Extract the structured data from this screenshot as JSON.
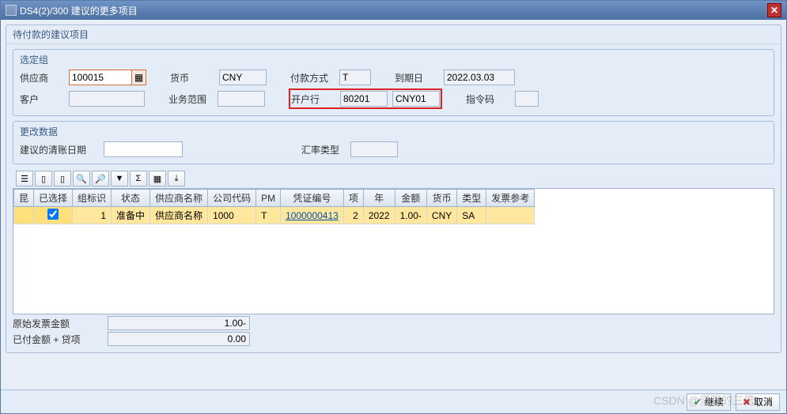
{
  "title": "DS4(2)/300 建议的更多项目",
  "group_main_title": "待付款的建议项目",
  "sel_group_title": "选定组",
  "fields": {
    "vendor_lbl": "供应商",
    "vendor_val": "100015",
    "customer_lbl": "客户",
    "customer_val": "",
    "currency_lbl": "货币",
    "currency_val": "CNY",
    "busarea_lbl": "业务范围",
    "busarea_val": "",
    "paymethod_lbl": "付款方式",
    "paymethod_val": "T",
    "bank_lbl": "开户行",
    "bank_val1": "80201",
    "bank_val2": "CNY01",
    "duedate_lbl": "到期日",
    "duedate_val": "2022.03.03",
    "instr_lbl": "指令码",
    "instr_val": ""
  },
  "change_group_title": "更改数据",
  "change": {
    "cleardate_lbl": "建议的清账日期",
    "cleardate_val": "",
    "ratetype_lbl": "汇率类型",
    "ratetype_val": ""
  },
  "columns": [
    "已选择",
    "组标识",
    "状态",
    "供应商名称",
    "公司代码",
    "PM",
    "凭证编号",
    "项",
    "年",
    "金额",
    "货币",
    "类型",
    "发票参考"
  ],
  "row": {
    "selected": true,
    "group": "1",
    "status": "准备中",
    "vendor": "供应商名称",
    "company": "1000",
    "pm": "T",
    "docno": "1000000413",
    "item": "2",
    "year": "2022",
    "amount": "1.00-",
    "curr": "CNY",
    "type": "SA",
    "invref": ""
  },
  "summary": {
    "orig_lbl": "原始发票金额",
    "orig_val": "1.00-",
    "paid_lbl": "已付金额 + 贷项",
    "paid_val": "0.00"
  },
  "footer": {
    "continue": "继续",
    "cancel": "取消"
  },
  "watermark": "CSDN @坚强的三倍"
}
